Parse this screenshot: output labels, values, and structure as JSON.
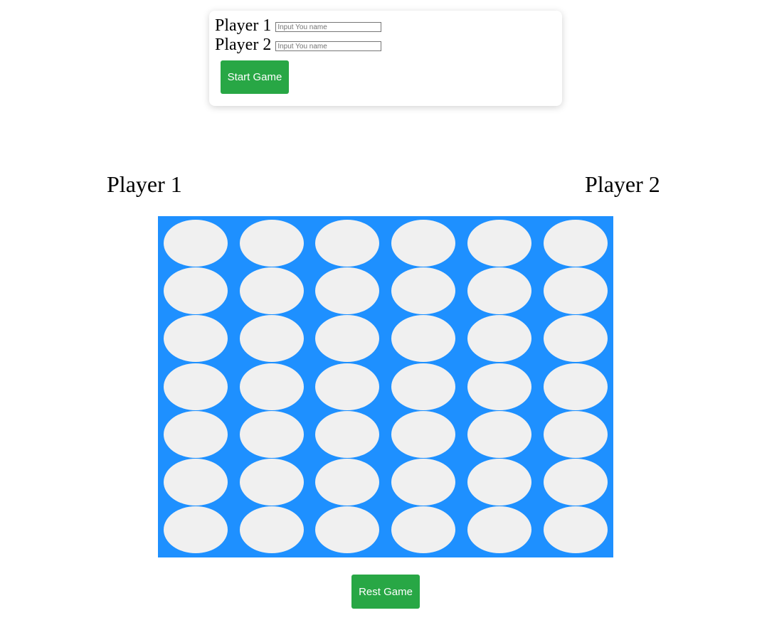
{
  "setup": {
    "player1_label": "Player 1",
    "player2_label": "Player 2",
    "name_placeholder": "Input You name",
    "player1_value": "",
    "player2_value": "",
    "start_label": "Start Game"
  },
  "scoreboard": {
    "player1": "Player 1",
    "player2": "Player 2"
  },
  "board": {
    "rows": 7,
    "columns": 6,
    "board_color": "#1e90ff",
    "empty_cell_color": "#f0f0f0"
  },
  "reset_label": "Rest Game",
  "colors": {
    "button": "#28a745",
    "button_text": "#ffffff"
  }
}
